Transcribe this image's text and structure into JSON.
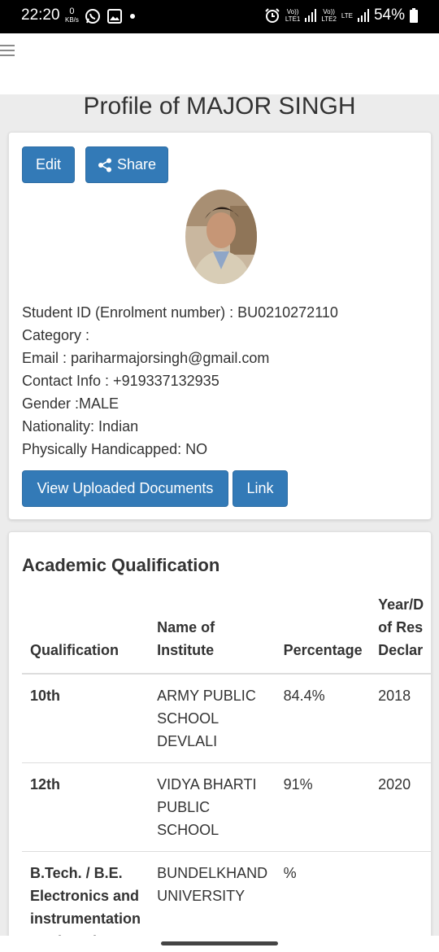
{
  "status_bar": {
    "time": "22:20",
    "net_speed_value": "0",
    "net_speed_unit": "KB/s",
    "volte1": "Vo))\nLTE1",
    "volte2": "Vo))\nLTE2",
    "lte": "LTE",
    "battery": "54%"
  },
  "page": {
    "title": "Profile of MAJOR SINGH"
  },
  "profile_card": {
    "edit_label": "Edit",
    "share_label": "Share",
    "info": [
      "Student ID (Enrolment number) : BU0210272110",
      "Category :",
      "Email : pariharmajorsingh@gmail.com",
      "Contact Info : +919337132935",
      "Gender :MALE",
      "Nationality: Indian",
      "Physically Handicapped: NO"
    ],
    "view_docs_label": "View Uploaded Documents",
    "link_label": "Link"
  },
  "academic": {
    "title": "Academic Qualification",
    "headers": {
      "qualification": "Qualification",
      "institute": "Name of\nInstitute",
      "percentage": "Percentage",
      "year": "Year/D\nof Res\nDeclar"
    },
    "rows": [
      {
        "qualification": "10th",
        "institute": "ARMY PUBLIC\nSCHOOL\nDEVLALI",
        "percentage": "84.4%",
        "year": "2018"
      },
      {
        "qualification": "12th",
        "institute": "VIDYA BHARTI\nPUBLIC\nSCHOOL",
        "percentage": "91%",
        "year": "2020"
      },
      {
        "qualification": "B.Tech. / B.E.\nElectronics and\ninstrumentation\nEngineering",
        "institute": "BUNDELKHAND\nUNIVERSITY",
        "percentage": "%",
        "year": ""
      }
    ]
  },
  "colors": {
    "primary_button": "#337ab7",
    "background": "#ececec"
  }
}
